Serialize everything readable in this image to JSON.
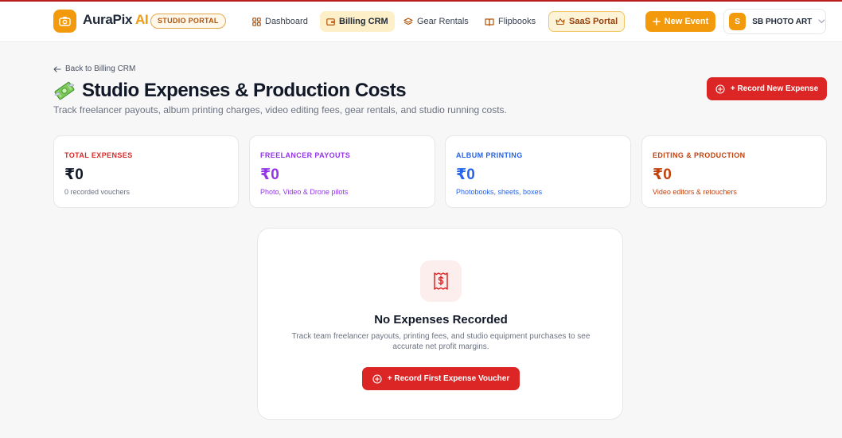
{
  "header": {
    "brand_name": "AuraPix",
    "brand_suffix": "AI",
    "portal_badge": "STUDIO PORTAL",
    "nav": [
      {
        "label": "Dashboard",
        "icon": "dashboard-grid-icon"
      },
      {
        "label": "Billing CRM",
        "icon": "wallet-icon",
        "active": true
      },
      {
        "label": "Gear Rentals",
        "icon": "layers-icon"
      },
      {
        "label": "Flipbooks",
        "icon": "book-open-icon"
      },
      {
        "label": "SaaS Portal",
        "icon": "crown-icon"
      }
    ],
    "new_event_label": "New Event",
    "account": {
      "initial": "S",
      "name": "SB PHOTO ART"
    }
  },
  "page": {
    "back_label": "Back to Billing CRM",
    "title_emoji": "💸",
    "title": "Studio Expenses & Production Costs",
    "subtitle": "Track freelancer payouts, album printing charges, video editing fees, gear rentals, and studio running costs.",
    "record_button": "+ Record New Expense"
  },
  "stats": [
    {
      "label": "TOTAL EXPENSES",
      "value": "₹0",
      "note": "0 recorded vouchers",
      "color": "#dc2626"
    },
    {
      "label": "FREELANCER PAYOUTS",
      "value": "₹0",
      "note": "Photo, Video & Drone pilots",
      "color": "#9333ea"
    },
    {
      "label": "ALBUM PRINTING",
      "value": "₹0",
      "note": "Photobooks, sheets, boxes",
      "color": "#2563eb"
    },
    {
      "label": "EDITING & PRODUCTION",
      "value": "₹0",
      "note": "Video editors & retouchers",
      "color": "#c2410c"
    }
  ],
  "empty_state": {
    "icon": "receipt-icon",
    "title": "No Expenses Recorded",
    "description": "Track team freelancer payouts, printing fees, and studio equipment purchases to see accurate net profit margins.",
    "button": "+ Record First Expense Voucher"
  },
  "colors": {
    "brand": "#f29a0c",
    "danger": "#dc2626"
  }
}
